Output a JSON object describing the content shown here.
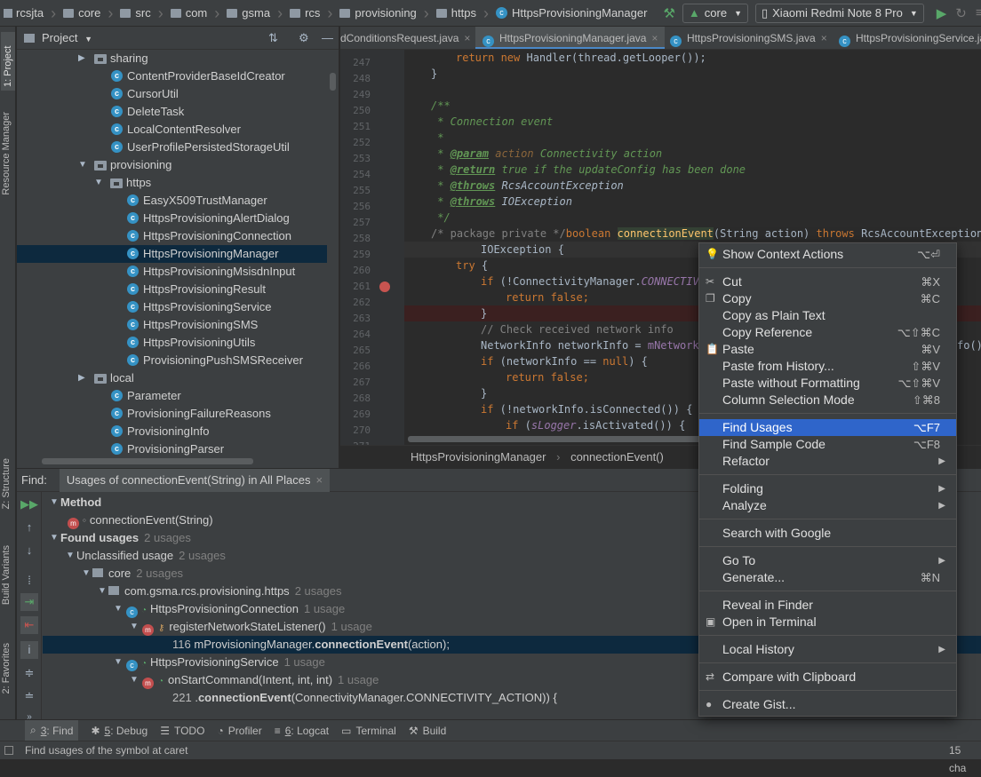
{
  "breadcrumb": [
    "rcsjta",
    "core",
    "src",
    "com",
    "gsma",
    "rcs",
    "provisioning",
    "https",
    "HttpsProvisioningManager"
  ],
  "toolbar": {
    "module": "core",
    "device": "Xiaomi Redmi Note 8 Pro"
  },
  "left_strip": {
    "project": "1: Project",
    "resource_manager": "Resource Manager",
    "structure": "Z: Structure",
    "build_variants": "Build Variants",
    "favorites": "2: Favorites"
  },
  "project_panel": {
    "title": "Project",
    "items": [
      {
        "label": "sharing",
        "type": "folder",
        "expanded": false
      },
      {
        "label": "ContentProviderBaseIdCreator",
        "type": "class"
      },
      {
        "label": "CursorUtil",
        "type": "class"
      },
      {
        "label": "DeleteTask",
        "type": "class"
      },
      {
        "label": "LocalContentResolver",
        "type": "class"
      },
      {
        "label": "UserProfilePersistedStorageUtil",
        "type": "class"
      },
      {
        "label": "provisioning",
        "type": "folder",
        "expanded": true
      },
      {
        "label": "https",
        "type": "folder",
        "expanded": true
      },
      {
        "label": "EasyX509TrustManager",
        "type": "class"
      },
      {
        "label": "HttpsProvisioningAlertDialog",
        "type": "class"
      },
      {
        "label": "HttpsProvisioningConnection",
        "type": "class"
      },
      {
        "label": "HttpsProvisioningManager",
        "type": "class",
        "selected": true
      },
      {
        "label": "HttpsProvisioningMsisdnInput",
        "type": "class"
      },
      {
        "label": "HttpsProvisioningResult",
        "type": "class"
      },
      {
        "label": "HttpsProvisioningService",
        "type": "class"
      },
      {
        "label": "HttpsProvisioningSMS",
        "type": "class"
      },
      {
        "label": "HttpsProvisioningUtils",
        "type": "class"
      },
      {
        "label": "ProvisioningPushSMSReceiver",
        "type": "class"
      },
      {
        "label": "local",
        "type": "folder",
        "expanded": false
      },
      {
        "label": "Parameter",
        "type": "class"
      },
      {
        "label": "ProvisioningFailureReasons",
        "type": "class"
      },
      {
        "label": "ProvisioningInfo",
        "type": "class"
      },
      {
        "label": "ProvisioningParser",
        "type": "class"
      }
    ]
  },
  "editor_tabs": [
    "dConditionsRequest.java",
    "HttpsProvisioningManager.java",
    "HttpsProvisioningSMS.java",
    "HttpsProvisioningService.java"
  ],
  "code": {
    "line_numbers": [
      "247",
      "248",
      "249",
      "250",
      "251",
      "252",
      "253",
      "254",
      "255",
      "256",
      "257",
      "258",
      "259",
      "260",
      "261",
      "262",
      "263",
      "264",
      "265",
      "266",
      "267",
      "268",
      "269",
      "270",
      "271"
    ],
    "l247_return": "return new Handler(thread.getLooper());",
    "l248": "}",
    "l250": "/**",
    "l251": " * Connection event",
    "l252": " *",
    "l253_tag": "@param",
    "l253_name": "action",
    "l253_text": "Connectivity action",
    "l254_tag": "@return",
    "l254_text": "true if the updateConfig has been done",
    "l255_tag": "@throws",
    "l255_text": "RcsAccountException",
    "l256_tag": "@throws",
    "l256_text": "IOException",
    "l257": " */",
    "l258_comment": "/* package private */",
    "l258_kw": "boolean",
    "l258_fn": "connectionEvent",
    "l258_params": "(String action) ",
    "l258_throws": "throws",
    "l258_rest": " RcsAccountException,",
    "l259": "IOException {",
    "l260": "try {",
    "l261_kw": "if",
    "l261_a": " (!ConnectivityManager.",
    "l261_field": "CONNECTIVI",
    "l262_kw": "return false;",
    "l263": "}",
    "l264": "// Check received network info",
    "l265_a": "NetworkInfo networkInfo = ",
    "l265_field": "mNetworkC",
    "l265_tail": "fo();",
    "l266_kw": "if",
    "l266_a": " (networkInfo == ",
    "l266_null": "null",
    "l266_b": ") {",
    "l267_kw": "return false;",
    "l268": "}",
    "l269_kw": "if",
    "l269_a": " (!networkInfo.isConnected()) {",
    "l270_kw": "if",
    "l270_a": " (",
    "l270_field": "sLogger",
    "l270_b": ".isActivated()) {"
  },
  "editor_breadcrumb": [
    "HttpsProvisioningManager",
    "connectionEvent()"
  ],
  "find_panel": {
    "label": "Find:",
    "tab": "Usages of connectionEvent(String) in All Places",
    "rows": {
      "method": "Method",
      "method_sig": "connectionEvent(String)",
      "found": "Found usages",
      "found_count": "2 usages",
      "unclassified": "Unclassified usage",
      "unclassified_count": "2 usages",
      "core": "core",
      "core_count": "2 usages",
      "pkg": "com.gsma.rcs.provisioning.https",
      "pkg_count": "2 usages",
      "conn": "HttpsProvisioningConnection",
      "conn_count": "1 usage",
      "register": "registerNetworkStateListener()",
      "register_count": "1 usage",
      "u1_line": "116",
      "u1_pre": "mProvisioningManager.",
      "u1_bold": "connectionEvent",
      "u1_post": "(action);",
      "service": "HttpsProvisioningService",
      "service_count": "1 usage",
      "onstart": "onStartCommand(Intent, int, int)",
      "onstart_count": "1 usage",
      "u2_line": "221",
      "u2_pre": ".",
      "u2_bold": "connectionEvent",
      "u2_post": "(ConnectivityManager.CONNECTIVITY_ACTION)) {"
    }
  },
  "context_menu": [
    {
      "label": "Show Context Actions",
      "shortcut": "⌥⏎",
      "icon": "bulb"
    },
    {
      "label": "Cut",
      "shortcut": "⌘X",
      "icon": "scissors"
    },
    {
      "label": "Copy",
      "shortcut": "⌘C",
      "icon": "copy"
    },
    {
      "label": "Copy as Plain Text",
      "shortcut": ""
    },
    {
      "label": "Copy Reference",
      "shortcut": "⌥⇧⌘C"
    },
    {
      "label": "Paste",
      "shortcut": "⌘V",
      "icon": "clipboard"
    },
    {
      "label": "Paste from History...",
      "shortcut": "⇧⌘V"
    },
    {
      "label": "Paste without Formatting",
      "shortcut": "⌥⇧⌘V"
    },
    {
      "label": "Column Selection Mode",
      "shortcut": "⇧⌘8"
    },
    {
      "label": "Find Usages",
      "shortcut": "⌥F7",
      "selected": true
    },
    {
      "label": "Find Sample Code",
      "shortcut": "⌥F8"
    },
    {
      "label": "Refactor",
      "submenu": true
    },
    {
      "label": "Folding",
      "submenu": true
    },
    {
      "label": "Analyze",
      "submenu": true
    },
    {
      "label": "Search with Google"
    },
    {
      "label": "Go To",
      "submenu": true
    },
    {
      "label": "Generate...",
      "shortcut": "⌘N"
    },
    {
      "label": "Reveal in Finder"
    },
    {
      "label": "Open in Terminal",
      "icon": "terminal"
    },
    {
      "label": "Local History",
      "submenu": true
    },
    {
      "label": "Compare with Clipboard",
      "icon": "compare"
    },
    {
      "label": "Create Gist...",
      "icon": "github"
    }
  ],
  "bottom_tabs": [
    {
      "num": "3",
      "label": ": Find"
    },
    {
      "num": "5",
      "label": ": Debug"
    },
    {
      "num": "",
      "label": "TODO"
    },
    {
      "num": "",
      "label": "Profiler"
    },
    {
      "num": "6",
      "label": ": Logcat"
    },
    {
      "num": "",
      "label": "Terminal"
    },
    {
      "num": "",
      "label": "Build"
    }
  ],
  "status": {
    "message": "Find usages of the symbol at caret",
    "right": "15 cha"
  }
}
